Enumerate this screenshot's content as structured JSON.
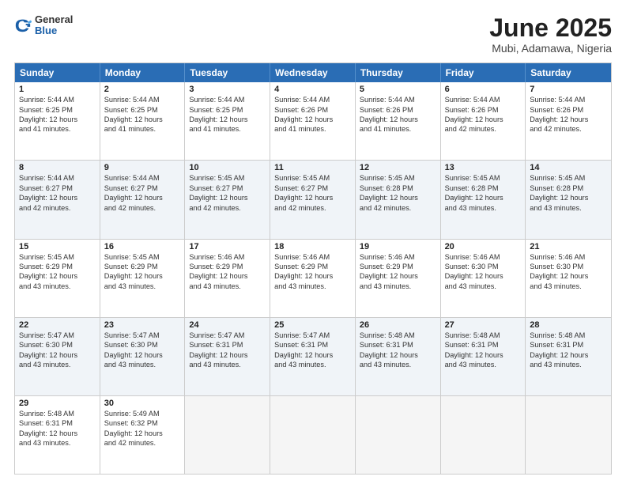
{
  "header": {
    "logo": {
      "general": "General",
      "blue": "Blue"
    },
    "title": "June 2025",
    "subtitle": "Mubi, Adamawa, Nigeria"
  },
  "weekdays": [
    "Sunday",
    "Monday",
    "Tuesday",
    "Wednesday",
    "Thursday",
    "Friday",
    "Saturday"
  ],
  "weeks": [
    [
      {
        "day": "1",
        "lines": [
          "Sunrise: 5:44 AM",
          "Sunset: 6:25 PM",
          "Daylight: 12 hours",
          "and 41 minutes."
        ],
        "shade": false
      },
      {
        "day": "2",
        "lines": [
          "Sunrise: 5:44 AM",
          "Sunset: 6:25 PM",
          "Daylight: 12 hours",
          "and 41 minutes."
        ],
        "shade": false
      },
      {
        "day": "3",
        "lines": [
          "Sunrise: 5:44 AM",
          "Sunset: 6:25 PM",
          "Daylight: 12 hours",
          "and 41 minutes."
        ],
        "shade": false
      },
      {
        "day": "4",
        "lines": [
          "Sunrise: 5:44 AM",
          "Sunset: 6:26 PM",
          "Daylight: 12 hours",
          "and 41 minutes."
        ],
        "shade": false
      },
      {
        "day": "5",
        "lines": [
          "Sunrise: 5:44 AM",
          "Sunset: 6:26 PM",
          "Daylight: 12 hours",
          "and 41 minutes."
        ],
        "shade": false
      },
      {
        "day": "6",
        "lines": [
          "Sunrise: 5:44 AM",
          "Sunset: 6:26 PM",
          "Daylight: 12 hours",
          "and 42 minutes."
        ],
        "shade": false
      },
      {
        "day": "7",
        "lines": [
          "Sunrise: 5:44 AM",
          "Sunset: 6:26 PM",
          "Daylight: 12 hours",
          "and 42 minutes."
        ],
        "shade": false
      }
    ],
    [
      {
        "day": "8",
        "lines": [
          "Sunrise: 5:44 AM",
          "Sunset: 6:27 PM",
          "Daylight: 12 hours",
          "and 42 minutes."
        ],
        "shade": true
      },
      {
        "day": "9",
        "lines": [
          "Sunrise: 5:44 AM",
          "Sunset: 6:27 PM",
          "Daylight: 12 hours",
          "and 42 minutes."
        ],
        "shade": true
      },
      {
        "day": "10",
        "lines": [
          "Sunrise: 5:45 AM",
          "Sunset: 6:27 PM",
          "Daylight: 12 hours",
          "and 42 minutes."
        ],
        "shade": true
      },
      {
        "day": "11",
        "lines": [
          "Sunrise: 5:45 AM",
          "Sunset: 6:27 PM",
          "Daylight: 12 hours",
          "and 42 minutes."
        ],
        "shade": true
      },
      {
        "day": "12",
        "lines": [
          "Sunrise: 5:45 AM",
          "Sunset: 6:28 PM",
          "Daylight: 12 hours",
          "and 42 minutes."
        ],
        "shade": true
      },
      {
        "day": "13",
        "lines": [
          "Sunrise: 5:45 AM",
          "Sunset: 6:28 PM",
          "Daylight: 12 hours",
          "and 43 minutes."
        ],
        "shade": true
      },
      {
        "day": "14",
        "lines": [
          "Sunrise: 5:45 AM",
          "Sunset: 6:28 PM",
          "Daylight: 12 hours",
          "and 43 minutes."
        ],
        "shade": true
      }
    ],
    [
      {
        "day": "15",
        "lines": [
          "Sunrise: 5:45 AM",
          "Sunset: 6:29 PM",
          "Daylight: 12 hours",
          "and 43 minutes."
        ],
        "shade": false
      },
      {
        "day": "16",
        "lines": [
          "Sunrise: 5:45 AM",
          "Sunset: 6:29 PM",
          "Daylight: 12 hours",
          "and 43 minutes."
        ],
        "shade": false
      },
      {
        "day": "17",
        "lines": [
          "Sunrise: 5:46 AM",
          "Sunset: 6:29 PM",
          "Daylight: 12 hours",
          "and 43 minutes."
        ],
        "shade": false
      },
      {
        "day": "18",
        "lines": [
          "Sunrise: 5:46 AM",
          "Sunset: 6:29 PM",
          "Daylight: 12 hours",
          "and 43 minutes."
        ],
        "shade": false
      },
      {
        "day": "19",
        "lines": [
          "Sunrise: 5:46 AM",
          "Sunset: 6:29 PM",
          "Daylight: 12 hours",
          "and 43 minutes."
        ],
        "shade": false
      },
      {
        "day": "20",
        "lines": [
          "Sunrise: 5:46 AM",
          "Sunset: 6:30 PM",
          "Daylight: 12 hours",
          "and 43 minutes."
        ],
        "shade": false
      },
      {
        "day": "21",
        "lines": [
          "Sunrise: 5:46 AM",
          "Sunset: 6:30 PM",
          "Daylight: 12 hours",
          "and 43 minutes."
        ],
        "shade": false
      }
    ],
    [
      {
        "day": "22",
        "lines": [
          "Sunrise: 5:47 AM",
          "Sunset: 6:30 PM",
          "Daylight: 12 hours",
          "and 43 minutes."
        ],
        "shade": true
      },
      {
        "day": "23",
        "lines": [
          "Sunrise: 5:47 AM",
          "Sunset: 6:30 PM",
          "Daylight: 12 hours",
          "and 43 minutes."
        ],
        "shade": true
      },
      {
        "day": "24",
        "lines": [
          "Sunrise: 5:47 AM",
          "Sunset: 6:31 PM",
          "Daylight: 12 hours",
          "and 43 minutes."
        ],
        "shade": true
      },
      {
        "day": "25",
        "lines": [
          "Sunrise: 5:47 AM",
          "Sunset: 6:31 PM",
          "Daylight: 12 hours",
          "and 43 minutes."
        ],
        "shade": true
      },
      {
        "day": "26",
        "lines": [
          "Sunrise: 5:48 AM",
          "Sunset: 6:31 PM",
          "Daylight: 12 hours",
          "and 43 minutes."
        ],
        "shade": true
      },
      {
        "day": "27",
        "lines": [
          "Sunrise: 5:48 AM",
          "Sunset: 6:31 PM",
          "Daylight: 12 hours",
          "and 43 minutes."
        ],
        "shade": true
      },
      {
        "day": "28",
        "lines": [
          "Sunrise: 5:48 AM",
          "Sunset: 6:31 PM",
          "Daylight: 12 hours",
          "and 43 minutes."
        ],
        "shade": true
      }
    ],
    [
      {
        "day": "29",
        "lines": [
          "Sunrise: 5:48 AM",
          "Sunset: 6:31 PM",
          "Daylight: 12 hours",
          "and 43 minutes."
        ],
        "shade": false
      },
      {
        "day": "30",
        "lines": [
          "Sunrise: 5:49 AM",
          "Sunset: 6:32 PM",
          "Daylight: 12 hours",
          "and 42 minutes."
        ],
        "shade": false
      },
      {
        "day": "",
        "lines": [],
        "shade": false,
        "empty": true
      },
      {
        "day": "",
        "lines": [],
        "shade": false,
        "empty": true
      },
      {
        "day": "",
        "lines": [],
        "shade": false,
        "empty": true
      },
      {
        "day": "",
        "lines": [],
        "shade": false,
        "empty": true
      },
      {
        "day": "",
        "lines": [],
        "shade": false,
        "empty": true
      }
    ]
  ]
}
